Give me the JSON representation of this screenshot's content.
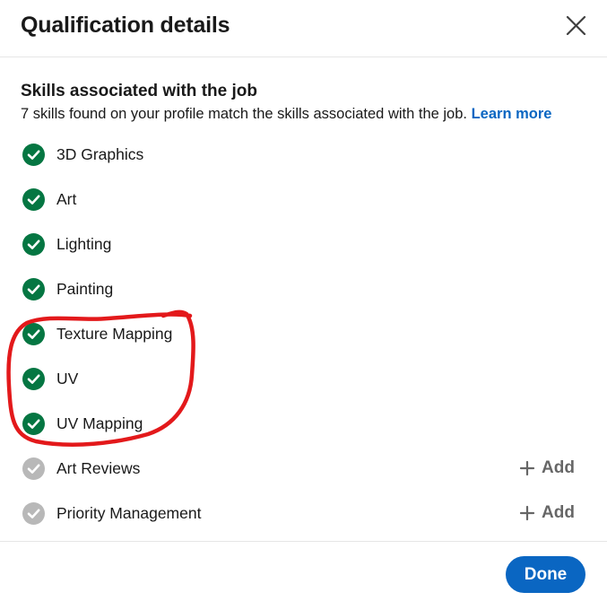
{
  "dialog": {
    "title": "Qualification details",
    "close_icon": "close-icon"
  },
  "section": {
    "title": "Skills associated with the job",
    "subtitle": "7 skills found on your profile match the skills associated with the job.",
    "learn_more": "Learn more"
  },
  "skills": [
    {
      "label": "3D Graphics",
      "matched": true
    },
    {
      "label": "Art",
      "matched": true
    },
    {
      "label": "Lighting",
      "matched": true
    },
    {
      "label": "Painting",
      "matched": true
    },
    {
      "label": "Texture Mapping",
      "matched": true
    },
    {
      "label": "UV",
      "matched": true
    },
    {
      "label": "UV Mapping",
      "matched": true
    },
    {
      "label": "Art Reviews",
      "matched": false,
      "action": "Add"
    },
    {
      "label": "Priority Management",
      "matched": false,
      "action": "Add"
    }
  ],
  "footer": {
    "done_label": "Done"
  },
  "colors": {
    "matched_check": "#057642",
    "unmatched_check": "#b8b8b8",
    "link": "#0a66c2",
    "primary_button": "#0a66c2",
    "annotation_stroke": "#e3191b"
  }
}
